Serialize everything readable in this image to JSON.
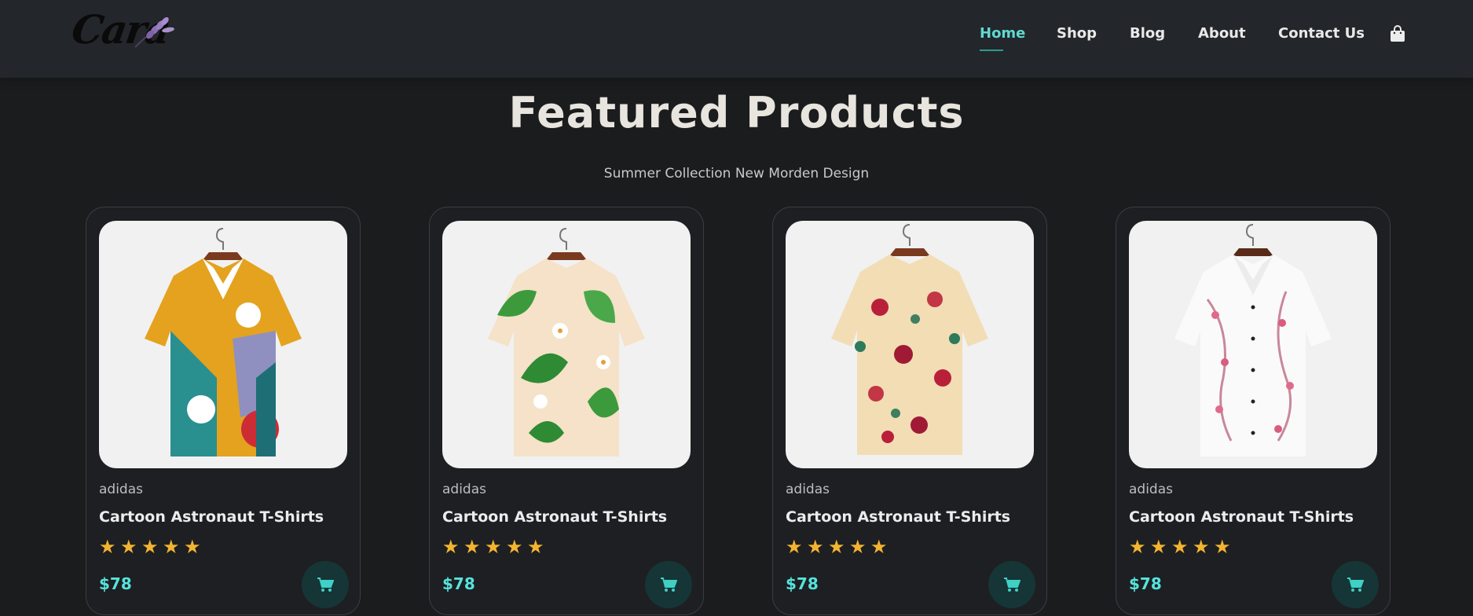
{
  "brand": {
    "logo_text": "Cara"
  },
  "nav": {
    "items": [
      {
        "label": "Home",
        "active": true
      },
      {
        "label": "Shop",
        "active": false
      },
      {
        "label": "Blog",
        "active": false
      },
      {
        "label": "About",
        "active": false
      },
      {
        "label": "Contact Us",
        "active": false
      }
    ],
    "cart_icon": "shopping-bag-icon"
  },
  "section": {
    "title": "Featured Products",
    "subtitle": "Summer Collection New Morden Design"
  },
  "products": [
    {
      "brand": "adidas",
      "name": "Cartoon Astronaut T-Shirts",
      "rating": 5,
      "price": "$78",
      "pattern": "abstract-multicolor"
    },
    {
      "brand": "adidas",
      "name": "Cartoon Astronaut T-Shirts",
      "rating": 5,
      "price": "$78",
      "pattern": "green-leaf-floral"
    },
    {
      "brand": "adidas",
      "name": "Cartoon Astronaut T-Shirts",
      "rating": 5,
      "price": "$78",
      "pattern": "red-rose-floral"
    },
    {
      "brand": "adidas",
      "name": "Cartoon Astronaut T-Shirts",
      "rating": 5,
      "price": "$78",
      "pattern": "pink-blossom-white"
    }
  ],
  "colors": {
    "background": "#1b1c1e",
    "header": "#23262a",
    "accent": "#5fd9d1",
    "price": "#55e3dc",
    "star": "#f3b431",
    "cart_button": "#163536"
  }
}
